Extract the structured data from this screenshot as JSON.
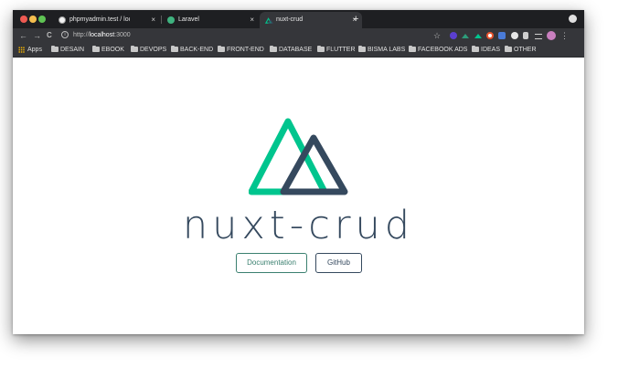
{
  "tabs": [
    {
      "title": "phpmyadmin.test / locall",
      "favicon_color": "#f2f2f2",
      "active": false
    },
    {
      "title": "Laravel",
      "favicon_color": "#3fb27f",
      "active": false
    },
    {
      "title": "nuxt-crud",
      "favicon_color": "#00c58e",
      "active": true
    }
  ],
  "tab_close_icon": "×",
  "new_tab_icon": "+",
  "toolbar": {
    "back_icon": "←",
    "forward_icon": "→",
    "reload_icon": "C",
    "info_icon": "i",
    "url_scheme": "http://",
    "url_host": "localhost",
    "url_port": ":3000",
    "star_icon": "☆"
  },
  "bookmarks": [
    {
      "label": "Apps",
      "icon": "apps-grid-icon"
    },
    {
      "label": "DESAIN",
      "icon": "folder-icon"
    },
    {
      "label": "EBOOK",
      "icon": "folder-icon"
    },
    {
      "label": "DEVOPS",
      "icon": "folder-icon"
    },
    {
      "label": "BACK-END",
      "icon": "folder-icon"
    },
    {
      "label": "FRONT-END",
      "icon": "folder-icon"
    },
    {
      "label": "DATABASE",
      "icon": "folder-icon"
    },
    {
      "label": "FLUTTER",
      "icon": "folder-icon"
    },
    {
      "label": "BISMA LABS",
      "icon": "folder-icon"
    },
    {
      "label": "FACEBOOK ADS",
      "icon": "folder-icon"
    },
    {
      "label": "IDEAS",
      "icon": "folder-icon"
    },
    {
      "label": "OTHER",
      "icon": "folder-icon"
    }
  ],
  "page": {
    "title": "nuxt-crud",
    "documentation_label": "Documentation",
    "github_label": "GitHub"
  },
  "colors": {
    "nuxt_green": "#00c58e",
    "nuxt_dark": "#35495e",
    "button_green": "#3b8070"
  }
}
